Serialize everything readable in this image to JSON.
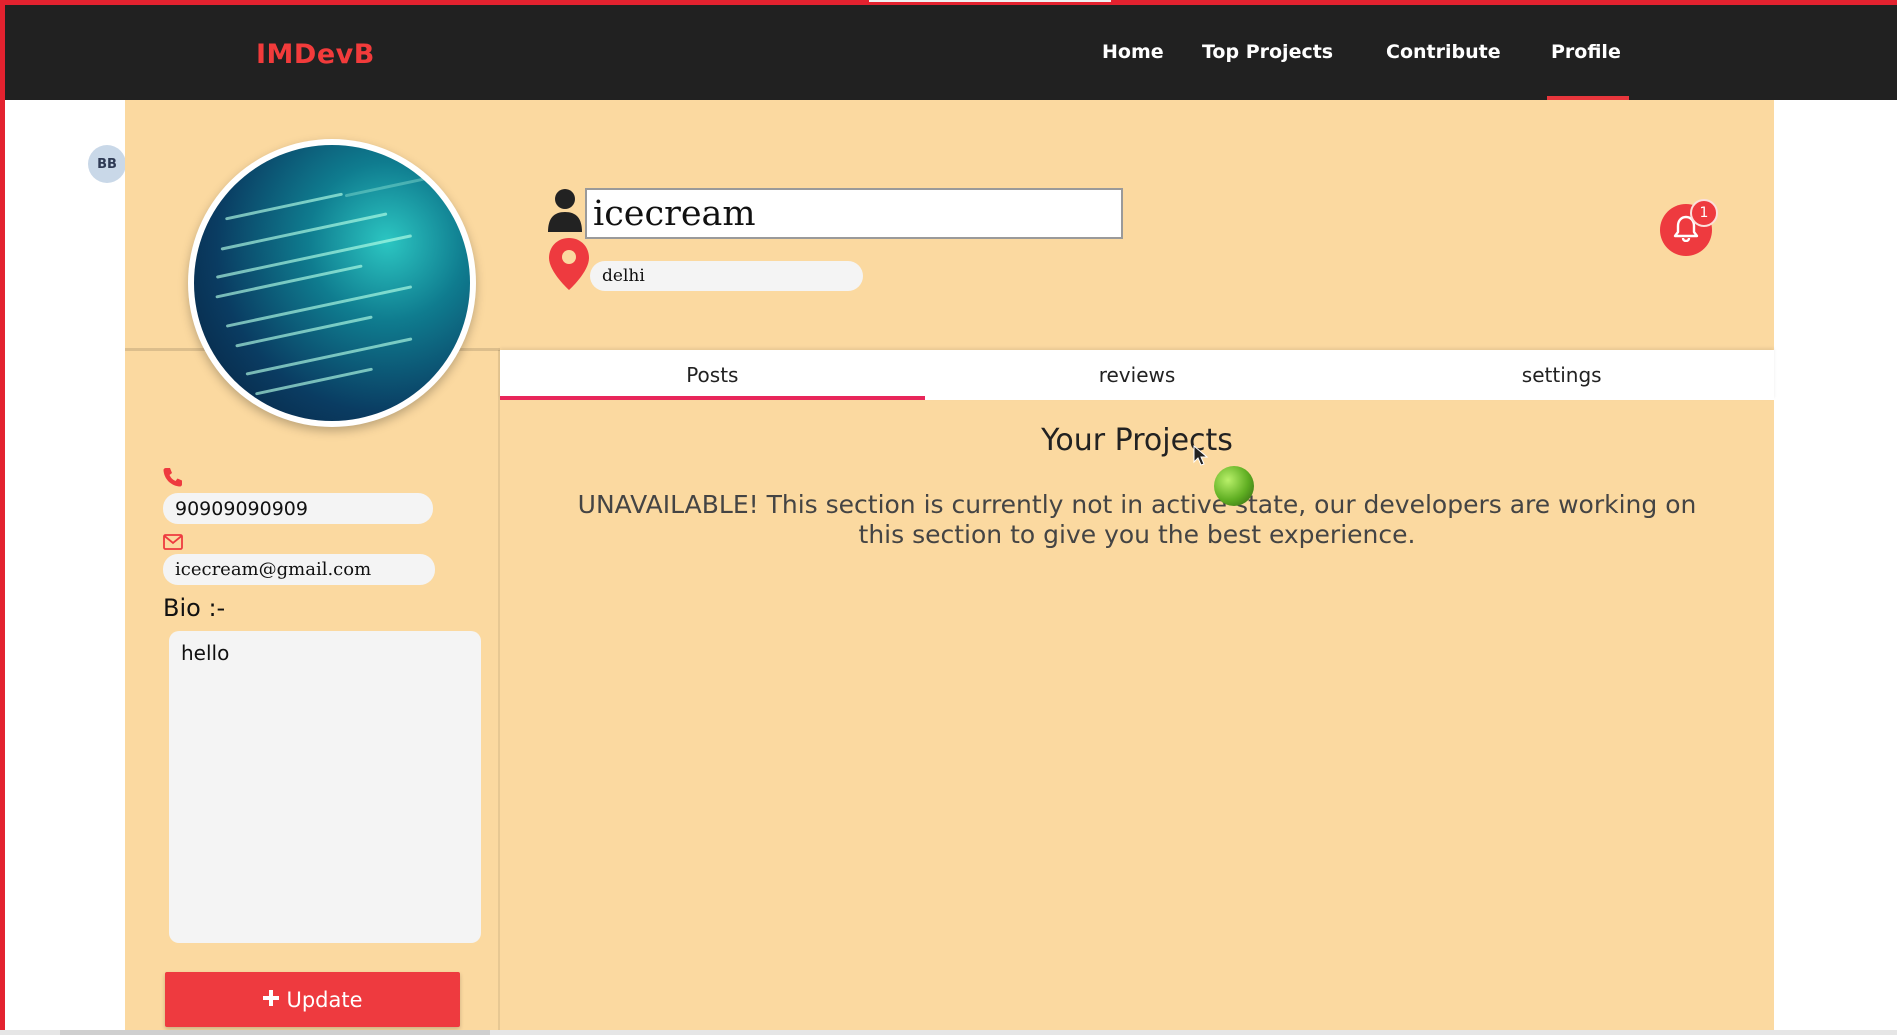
{
  "navbar": {
    "brand": "IMDevB",
    "links": [
      {
        "label": "Home"
      },
      {
        "label": "Top Projects"
      },
      {
        "label": "Contribute"
      },
      {
        "label": "Profile",
        "active": true
      }
    ]
  },
  "side_avatar": {
    "initials": "BB"
  },
  "profile": {
    "name": "icecream",
    "location": "delhi",
    "phone": "90909090909",
    "email": "icecream@gmail.com",
    "bio_label": "Bio :-",
    "bio": "hello",
    "update_label": "Update",
    "notification_count": "1"
  },
  "tabs": [
    {
      "label": "Posts",
      "active": true
    },
    {
      "label": "reviews"
    },
    {
      "label": "settings"
    }
  ],
  "content": {
    "title": "Your Projects",
    "message": "UNAVAILABLE! This section is currently not in active state, our developers are working on this section to give you the best experience."
  },
  "colors": {
    "accent": "#ee3a3f",
    "navbar_bg": "#212121",
    "card_bg": "#fbd9a0",
    "tab_underline": "#e8265a"
  },
  "icons": [
    "user-icon",
    "location-pin-icon",
    "bell-icon",
    "phone-icon",
    "mail-icon",
    "plus-icon",
    "mouse-cursor-icon"
  ]
}
